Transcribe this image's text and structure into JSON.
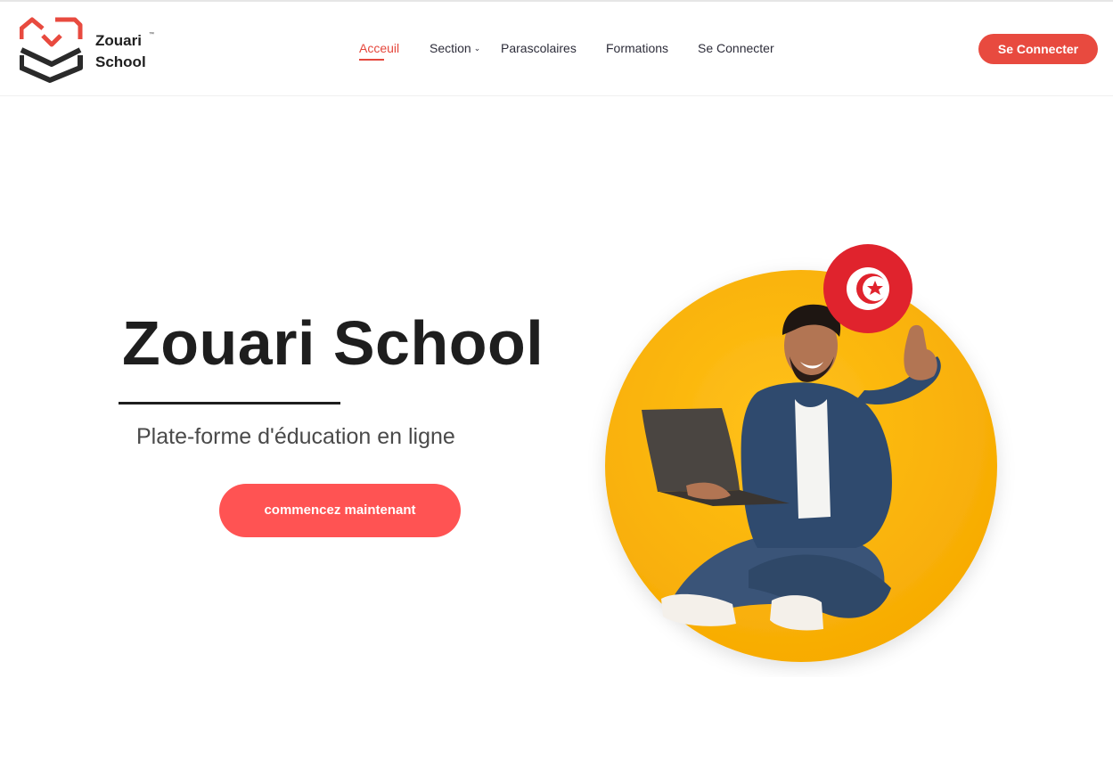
{
  "brand": {
    "name_line1": "Zouari",
    "name_line2": "School",
    "trademark": "™"
  },
  "nav": {
    "items": [
      {
        "label": "Acceuil",
        "active": true
      },
      {
        "label": "Section",
        "has_dropdown": true
      },
      {
        "label": "Parascolaires"
      },
      {
        "label": "Formations"
      },
      {
        "label": "Se Connecter"
      }
    ],
    "dropdown_glyph": "⌄"
  },
  "header_button": {
    "label": "Se Connecter"
  },
  "hero": {
    "title": "Zouari School",
    "subtitle": "Plate-forme d'éducation en ligne",
    "cta_label": "commencez maintenant",
    "image": "student-with-laptop-thumbs-up",
    "badge": "tunisia-flag-icon"
  },
  "colors": {
    "accent": "#e84a3f",
    "cta": "#ff5353",
    "hero_circle": "#fbb30a",
    "flag_red": "#e0232d"
  }
}
